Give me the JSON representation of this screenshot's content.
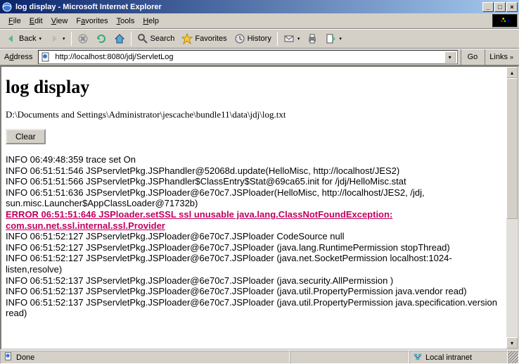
{
  "window": {
    "title": "log display - Microsoft Internet Explorer"
  },
  "menu": {
    "file": "File",
    "edit": "Edit",
    "view": "View",
    "favorites": "Favorites",
    "tools": "Tools",
    "help": "Help"
  },
  "toolbar": {
    "back": "Back",
    "search": "Search",
    "favorites": "Favorites",
    "history": "History"
  },
  "address": {
    "label": "Address",
    "value": "http://localhost:8080/jdj/ServletLog",
    "go": "Go",
    "links": "Links"
  },
  "page": {
    "heading": "log display",
    "path": "D:\\Documents and Settings\\Administrator\\jescache\\bundle11\\data\\jdj\\log.txt",
    "clear": "Clear",
    "lines": [
      {
        "t": "INFO 06:49:48:359 trace set On",
        "err": false
      },
      {
        "t": "INFO 06:51:51:546 JSPservletPkg.JSPhandler@52068d.update(HelloMisc, http://localhost/JES2)",
        "err": false
      },
      {
        "t": "INFO 06:51:51:566 JSPservletPkg.JSPhandler$ClassEntry$Stat@69ca65.init for /jdj/HelloMisc.stat",
        "err": false
      },
      {
        "t": "INFO 06:51:51:636 JSPservletPkg.JSPloader@6e70c7.JSPloader(HelloMisc, http://localhost/JES2, /jdj, sun.misc.Launcher$AppClassLoader@71732b)",
        "err": false
      },
      {
        "t": "ERROR 06:51:51:646 JSPloader.setSSL ssl unusable java.lang.ClassNotFoundException: com.sun.net.ssl.internal.ssl.Provider",
        "err": true
      },
      {
        "t": "INFO 06:51:52:127 JSPservletPkg.JSPloader@6e70c7.JSPloader CodeSource null",
        "err": false
      },
      {
        "t": "INFO 06:51:52:127 JSPservletPkg.JSPloader@6e70c7.JSPloader (java.lang.RuntimePermission stopThread)",
        "err": false
      },
      {
        "t": "INFO 06:51:52:127 JSPservletPkg.JSPloader@6e70c7.JSPloader (java.net.SocketPermission localhost:1024- listen,resolve)",
        "err": false
      },
      {
        "t": "INFO 06:51:52:137 JSPservletPkg.JSPloader@6e70c7.JSPloader (java.security.AllPermission )",
        "err": false
      },
      {
        "t": "INFO 06:51:52:137 JSPservletPkg.JSPloader@6e70c7.JSPloader (java.util.PropertyPermission java.vendor read)",
        "err": false
      },
      {
        "t": "INFO 06:51:52:137 JSPservletPkg.JSPloader@6e70c7.JSPloader (java.util.PropertyPermission java.specification.version read)",
        "err": false
      }
    ]
  },
  "status": {
    "done": "Done",
    "zone": "Local intranet"
  }
}
